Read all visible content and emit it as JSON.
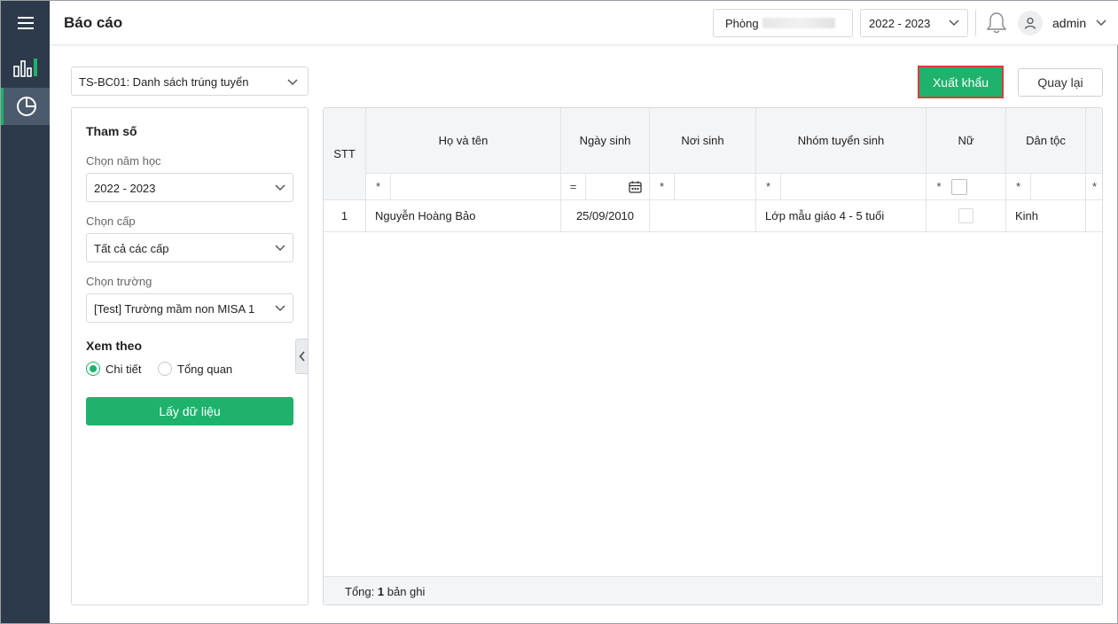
{
  "app": {
    "page_title": "Báo cáo"
  },
  "header": {
    "phong_label": "Phòng",
    "year": "2022 - 2023",
    "user": "admin"
  },
  "report": {
    "selected": "TS-BC01: Danh sách trúng tuyển"
  },
  "actions": {
    "export_label": "Xuất khẩu",
    "back_label": "Quay lại"
  },
  "params": {
    "title": "Tham số",
    "year_label": "Chọn năm học",
    "year_value": "2022 - 2023",
    "level_label": "Chọn cấp",
    "level_value": "Tất cả các cấp",
    "school_label": "Chọn trường",
    "school_value": "[Test] Trường mầm non MISA 1",
    "view_label": "Xem theo",
    "view_options": [
      "Chi tiết",
      "Tổng quan"
    ],
    "view_selected": "Chi tiết",
    "fetch_label": "Lấy dữ liệu"
  },
  "table": {
    "columns": [
      "STT",
      "Họ và tên",
      "Ngày sinh",
      "Nơi sinh",
      "Nhóm tuyển sinh",
      "Nữ",
      "Dân tộc"
    ],
    "filter_ops": [
      "*",
      "=",
      "*",
      "*",
      "*",
      "*",
      "*"
    ],
    "rows": [
      {
        "stt": "1",
        "name": "Nguyễn Hoàng Bảo",
        "dob": "25/09/2010",
        "birthplace": "",
        "group": "Lớp mẫu giáo 4 - 5 tuổi",
        "female": false,
        "ethnicity": "Kinh"
      }
    ],
    "footer_prefix": "Tổng:",
    "footer_count": "1",
    "footer_suffix": "bản ghi"
  },
  "colors": {
    "accent": "#1eb26c",
    "rail": "#2d3a4b",
    "highlight": "#e0393e"
  }
}
